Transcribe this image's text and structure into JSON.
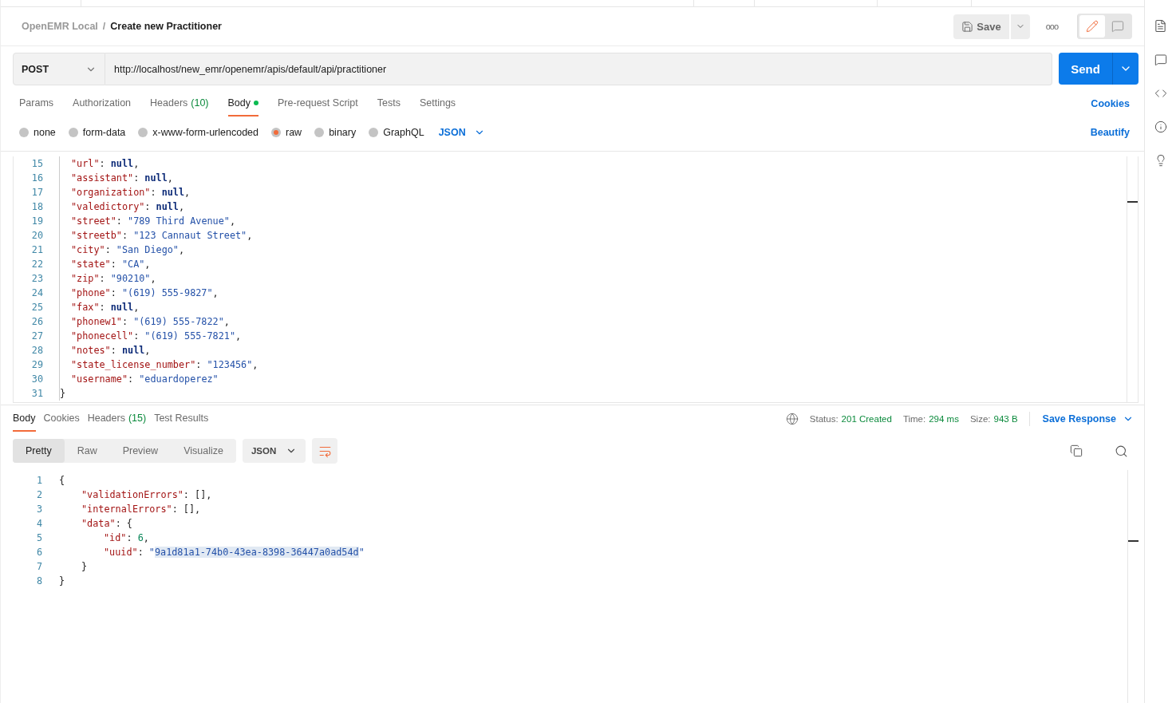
{
  "breadcrumb": {
    "collection": "OpenEMR Local",
    "separator": "/",
    "request": "Create new Practitioner"
  },
  "header_actions": {
    "save": "Save",
    "more": "ooo",
    "mode": [
      {
        "kind": "edit",
        "selected": true
      },
      {
        "kind": "comment",
        "selected": false
      }
    ]
  },
  "request": {
    "method": "POST",
    "url": "http://localhost/new_emr/openemr/apis/default/api/practitioner",
    "send": "Send"
  },
  "request_tabs": [
    {
      "label": "Params",
      "selected": false
    },
    {
      "label": "Authorization",
      "selected": false
    },
    {
      "label": "Headers",
      "count": "(10)",
      "selected": false
    },
    {
      "label": "Body",
      "selected": true,
      "dot": true
    },
    {
      "label": "Pre-request Script",
      "selected": false
    },
    {
      "label": "Tests",
      "selected": false
    },
    {
      "label": "Settings",
      "selected": false
    }
  ],
  "cookies_link": "Cookies",
  "body_types": [
    {
      "label": "none",
      "selected": false
    },
    {
      "label": "form-data",
      "selected": false
    },
    {
      "label": "x-www-form-urlencoded",
      "selected": false
    },
    {
      "label": "raw",
      "selected": true
    },
    {
      "label": "binary",
      "selected": false
    },
    {
      "label": "GraphQL",
      "selected": false
    }
  ],
  "body_format": "JSON",
  "beautify": "Beautify",
  "request_body": {
    "lines": [
      {
        "num": "15",
        "tokens": [
          {
            "kind": "key",
            "text": "\"url\""
          },
          {
            "kind": "punct",
            "text": ": "
          },
          {
            "kind": "null",
            "text": "null"
          },
          {
            "kind": "punct",
            "text": ","
          }
        ]
      },
      {
        "num": "16",
        "tokens": [
          {
            "kind": "key",
            "text": "\"assistant\""
          },
          {
            "kind": "punct",
            "text": ": "
          },
          {
            "kind": "null",
            "text": "null"
          },
          {
            "kind": "punct",
            "text": ","
          }
        ]
      },
      {
        "num": "17",
        "tokens": [
          {
            "kind": "key",
            "text": "\"organization\""
          },
          {
            "kind": "punct",
            "text": ": "
          },
          {
            "kind": "null",
            "text": "null"
          },
          {
            "kind": "punct",
            "text": ","
          }
        ]
      },
      {
        "num": "18",
        "tokens": [
          {
            "kind": "key",
            "text": "\"valedictory\""
          },
          {
            "kind": "punct",
            "text": ": "
          },
          {
            "kind": "null",
            "text": "null"
          },
          {
            "kind": "punct",
            "text": ","
          }
        ]
      },
      {
        "num": "19",
        "tokens": [
          {
            "kind": "key",
            "text": "\"street\""
          },
          {
            "kind": "punct",
            "text": ": "
          },
          {
            "kind": "string",
            "text": "\"789 Third Avenue\""
          },
          {
            "kind": "punct",
            "text": ","
          }
        ]
      },
      {
        "num": "20",
        "tokens": [
          {
            "kind": "key",
            "text": "\"streetb\""
          },
          {
            "kind": "punct",
            "text": ": "
          },
          {
            "kind": "string",
            "text": "\"123 Cannaut Street\""
          },
          {
            "kind": "punct",
            "text": ","
          }
        ]
      },
      {
        "num": "21",
        "tokens": [
          {
            "kind": "key",
            "text": "\"city\""
          },
          {
            "kind": "punct",
            "text": ": "
          },
          {
            "kind": "string",
            "text": "\"San Diego\""
          },
          {
            "kind": "punct",
            "text": ","
          }
        ]
      },
      {
        "num": "22",
        "tokens": [
          {
            "kind": "key",
            "text": "\"state\""
          },
          {
            "kind": "punct",
            "text": ": "
          },
          {
            "kind": "string",
            "text": "\"CA\""
          },
          {
            "kind": "punct",
            "text": ","
          }
        ]
      },
      {
        "num": "23",
        "tokens": [
          {
            "kind": "key",
            "text": "\"zip\""
          },
          {
            "kind": "punct",
            "text": ": "
          },
          {
            "kind": "string",
            "text": "\"90210\""
          },
          {
            "kind": "punct",
            "text": ","
          }
        ]
      },
      {
        "num": "24",
        "tokens": [
          {
            "kind": "key",
            "text": "\"phone\""
          },
          {
            "kind": "punct",
            "text": ": "
          },
          {
            "kind": "string",
            "text": "\"(619) 555-9827\""
          },
          {
            "kind": "punct",
            "text": ","
          }
        ]
      },
      {
        "num": "25",
        "tokens": [
          {
            "kind": "key",
            "text": "\"fax\""
          },
          {
            "kind": "punct",
            "text": ": "
          },
          {
            "kind": "null",
            "text": "null"
          },
          {
            "kind": "punct",
            "text": ","
          }
        ]
      },
      {
        "num": "26",
        "tokens": [
          {
            "kind": "key",
            "text": "\"phonew1\""
          },
          {
            "kind": "punct",
            "text": ": "
          },
          {
            "kind": "string",
            "text": "\"(619) 555-7822\""
          },
          {
            "kind": "punct",
            "text": ","
          }
        ]
      },
      {
        "num": "27",
        "tokens": [
          {
            "kind": "key",
            "text": "\"phonecell\""
          },
          {
            "kind": "punct",
            "text": ": "
          },
          {
            "kind": "string",
            "text": "\"(619) 555-7821\""
          },
          {
            "kind": "punct",
            "text": ","
          }
        ]
      },
      {
        "num": "28",
        "tokens": [
          {
            "kind": "key",
            "text": "\"notes\""
          },
          {
            "kind": "punct",
            "text": ": "
          },
          {
            "kind": "null",
            "text": "null"
          },
          {
            "kind": "punct",
            "text": ","
          }
        ]
      },
      {
        "num": "29",
        "tokens": [
          {
            "kind": "key",
            "text": "\"state_license_number\""
          },
          {
            "kind": "punct",
            "text": ": "
          },
          {
            "kind": "string",
            "text": "\"123456\""
          },
          {
            "kind": "punct",
            "text": ","
          }
        ]
      },
      {
        "num": "30",
        "tokens": [
          {
            "kind": "key",
            "text": "\"username\""
          },
          {
            "kind": "punct",
            "text": ": "
          },
          {
            "kind": "string",
            "text": "\"eduardoperez\""
          }
        ]
      }
    ],
    "close": {
      "num": "31",
      "text": "}"
    }
  },
  "response_tabs": [
    {
      "label": "Body",
      "selected": true
    },
    {
      "label": "Cookies",
      "selected": false
    },
    {
      "label": "Headers",
      "count": "(15)",
      "selected": false
    },
    {
      "label": "Test Results",
      "selected": false
    }
  ],
  "response_meta": {
    "status_label": "Status:",
    "status": "201 Created",
    "time_label": "Time:",
    "time": "294 ms",
    "size_label": "Size:",
    "size": "943 B",
    "save_response": "Save Response"
  },
  "view_modes": [
    {
      "label": "Pretty",
      "selected": true
    },
    {
      "label": "Raw",
      "selected": false
    },
    {
      "label": "Preview",
      "selected": false
    },
    {
      "label": "Visualize",
      "selected": false
    }
  ],
  "response_format": "JSON",
  "response_body": {
    "num": "1",
    "tokens": [
      {
        "kind": "punct",
        "text": "{"
      }
    ],
    "children": [
      {
        "num": "2",
        "tokens": [
          {
            "kind": "key",
            "text": "\"validationErrors\""
          },
          {
            "kind": "punct",
            "text": ": [],"
          }
        ]
      },
      {
        "num": "3",
        "tokens": [
          {
            "kind": "key",
            "text": "\"internalErrors\""
          },
          {
            "kind": "punct",
            "text": ": [],"
          }
        ]
      },
      {
        "num": "4",
        "tokens": [
          {
            "kind": "key",
            "text": "\"data\""
          },
          {
            "kind": "punct",
            "text": ": {"
          }
        ],
        "children": [
          {
            "num": "5",
            "tokens": [
              {
                "kind": "key",
                "text": "\"id\""
              },
              {
                "kind": "punct",
                "text": ": "
              },
              {
                "kind": "number",
                "text": "6"
              },
              {
                "kind": "punct",
                "text": ","
              }
            ]
          },
          {
            "num": "6",
            "tokens": [
              {
                "kind": "key",
                "text": "\"uuid\""
              },
              {
                "kind": "punct",
                "text": ": "
              },
              {
                "kind": "string",
                "text": "\""
              },
              {
                "kind": "string",
                "text": "9a1d81a1-74b0-43ea-8398-36447a0ad54d",
                "selected": true
              },
              {
                "kind": "string",
                "text": "\""
              }
            ]
          }
        ],
        "close": {
          "num": "7",
          "text": "}"
        }
      }
    ],
    "close": {
      "num": "8",
      "text": "}"
    }
  }
}
